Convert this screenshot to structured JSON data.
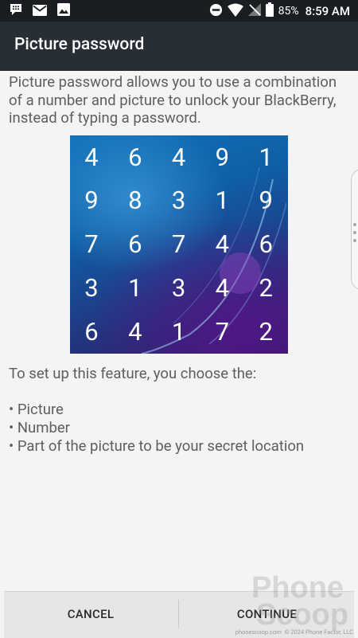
{
  "status_bar": {
    "battery": "85%",
    "time": "8:59 AM"
  },
  "app_bar": {
    "title": "Picture password"
  },
  "intro_text": "Picture password allows you to use a combination of a number and picture to unlock your BlackBerry, instead of typing a password.",
  "number_grid": [
    [
      "4",
      "6",
      "4",
      "9",
      "1"
    ],
    [
      "9",
      "8",
      "3",
      "1",
      "9"
    ],
    [
      "7",
      "6",
      "7",
      "4",
      "6"
    ],
    [
      "3",
      "1",
      "3",
      "4",
      "2"
    ],
    [
      "6",
      "4",
      "1",
      "7",
      "2"
    ]
  ],
  "setup_heading": "To set up this feature, you choose the:",
  "setup_items": [
    "Picture",
    "Number",
    "Part of the picture to be your secret location"
  ],
  "buttons": {
    "cancel": "CANCEL",
    "continue": "CONTINUE"
  },
  "watermark": {
    "line1": "Phone",
    "line2": "Scoop",
    "url": "phonescoop.com",
    "copyright": "© 2024 Phone Factor, LLC"
  },
  "icons": {
    "status_left": [
      "bbm-notification-icon",
      "gmail-notification-icon",
      "gallery-notification-icon"
    ],
    "status_right": [
      "do-not-disturb-icon",
      "wifi-icon",
      "no-signal-icon",
      "battery-icon"
    ]
  }
}
